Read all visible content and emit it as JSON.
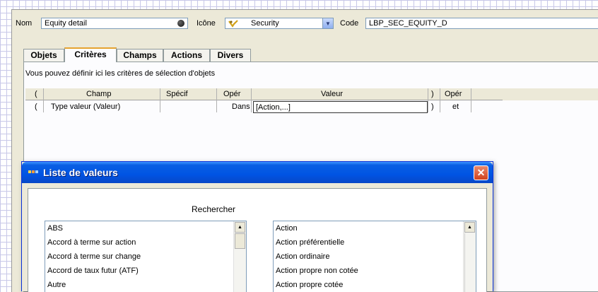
{
  "header": {
    "nom_label": "Nom",
    "nom_value": "Equity detail",
    "icone_label": "Icône",
    "icone_value": "Security",
    "code_label": "Code",
    "code_value": "LBP_SEC_EQUITY_D"
  },
  "tabs": [
    {
      "label": "Objets"
    },
    {
      "label": "Critères"
    },
    {
      "label": "Champs"
    },
    {
      "label": "Actions"
    },
    {
      "label": "Divers"
    }
  ],
  "criteria": {
    "description": "Vous pouvez définir ici les critères de sélection d'objets",
    "columns": [
      "(",
      "Champ",
      "Spécif",
      "Opér",
      "Valeur",
      ")",
      "Opér"
    ],
    "rows": [
      {
        "open": "(",
        "champ": "Type valeur (Valeur)",
        "specif": "",
        "oper": "Dans",
        "valeur": "[Action,...]",
        "close": ")",
        "oper2": "et"
      }
    ]
  },
  "dialog": {
    "title": "Liste de valeurs",
    "search_label": "Rechercher",
    "left_list": [
      "ABS",
      "Accord à terme sur action",
      "Accord à terme sur change",
      "Accord de taux futur (ATF)",
      "Autre"
    ],
    "right_list": [
      "Action",
      "Action préférentielle",
      "Action ordinaire",
      "Action propre non cotée",
      "Action propre cotée"
    ]
  }
}
